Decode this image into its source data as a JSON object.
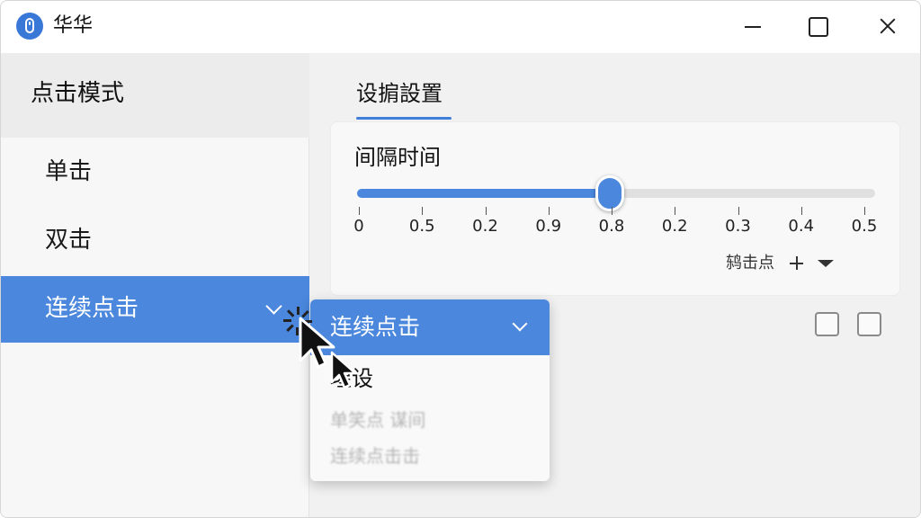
{
  "window": {
    "title": "华华",
    "icon": "mouse-icon"
  },
  "sidebar": {
    "title": "点击模式",
    "items": [
      {
        "label": "单击",
        "selected": false
      },
      {
        "label": "双击",
        "selected": false
      },
      {
        "label": "连续点击",
        "selected": true
      }
    ]
  },
  "panel": {
    "tab": "设掮設置",
    "card": {
      "label": "间隔时间",
      "slider": {
        "ticks": [
          "0",
          "0.5",
          "0.2",
          "0.9",
          "0.8",
          "0.2",
          "0.3",
          "0.4",
          "0.5"
        ],
        "value_fraction": 0.49
      },
      "hint": "鸫击点"
    }
  },
  "dropdown": {
    "selected": "连续点击",
    "options": [
      "瑆设",
      "单笑点 谋间",
      "连续点击击"
    ]
  },
  "colors": {
    "accent": "#4a87dd",
    "window_bg": "#f1f1f1"
  }
}
